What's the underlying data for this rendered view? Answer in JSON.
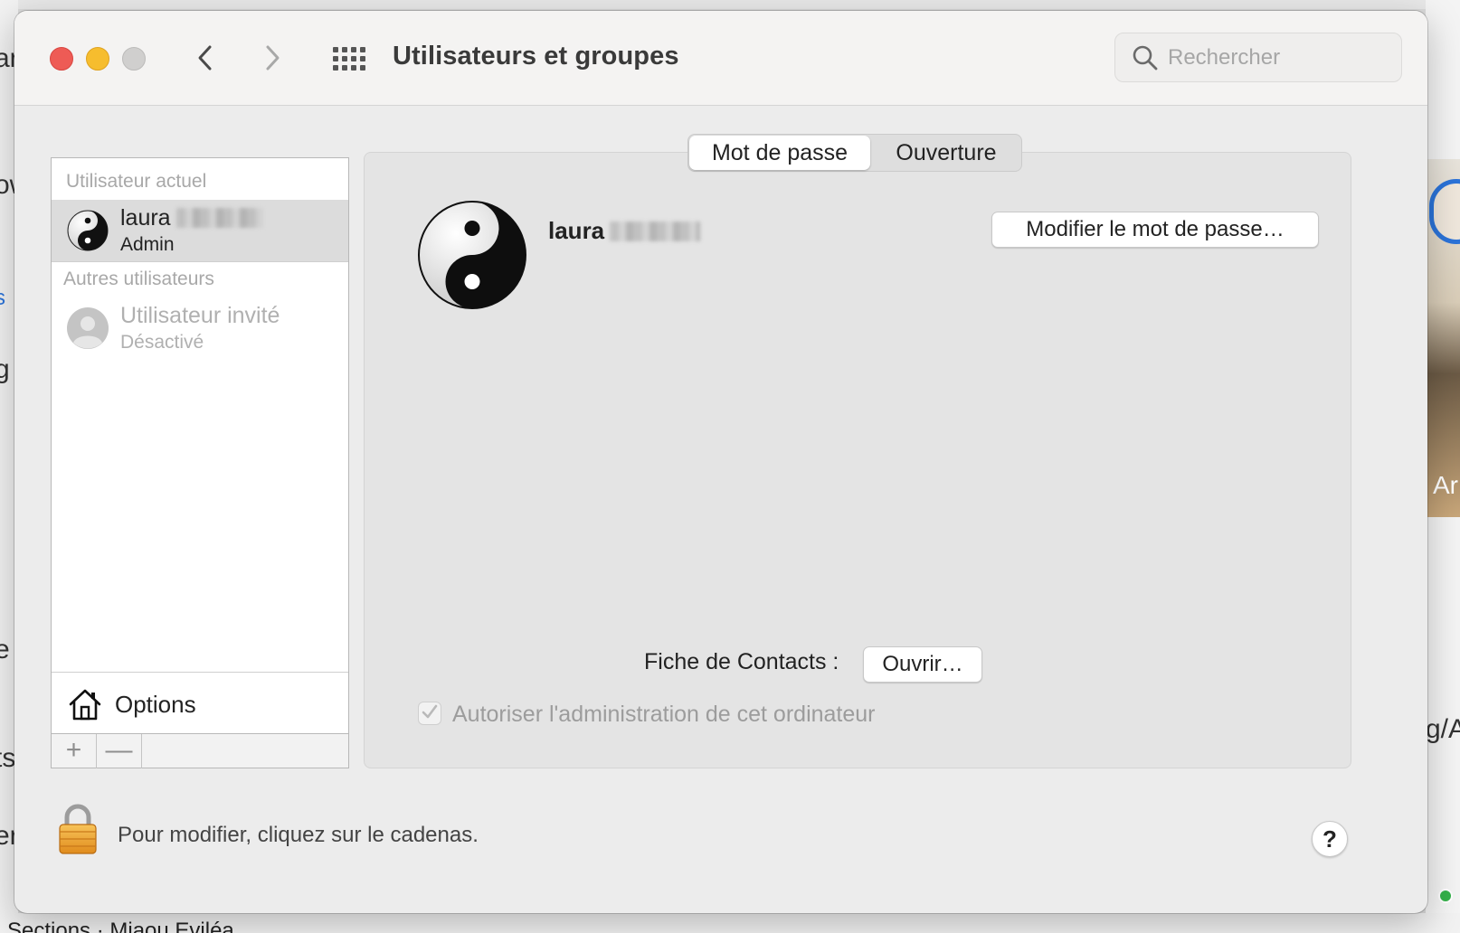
{
  "window": {
    "title": "Utilisateurs et groupes",
    "search_placeholder": "Rechercher"
  },
  "sidebar": {
    "current_label": "Utilisateur actuel",
    "current_user": {
      "name": "laura",
      "role": "Admin"
    },
    "others_label": "Autres utilisateurs",
    "guest_user": {
      "name": "Utilisateur invité",
      "status": "Désactivé"
    },
    "options_label": "Options",
    "add_symbol": "+",
    "remove_symbol": "—"
  },
  "tabs": [
    {
      "label": "Mot de passe",
      "selected": true
    },
    {
      "label": "Ouverture",
      "selected": false
    }
  ],
  "detail": {
    "user_name": "laura",
    "change_password_button": "Modifier le mot de passe…",
    "contacts_label": "Fiche de Contacts :",
    "open_button": "Ouvrir…",
    "admin_checkbox_label": "Autoriser l'administration de cet ordinateur",
    "admin_checked": true
  },
  "footer": {
    "lock_text": "Pour modifier, cliquez sur le cadenas.",
    "help_symbol": "?"
  },
  "background": {
    "left_fragments": [
      "ar",
      "ow",
      "s",
      "g",
      "e",
      "ts",
      "er"
    ],
    "right_fragments": [
      "Ar",
      "g/A"
    ],
    "bottom_fragment": "Sections · Miaou Eviléa"
  },
  "colors": {
    "close": "#ee5b55",
    "minimize": "#f6bd2e",
    "zoom_disabled": "#d0cfce",
    "selection": "#dcdcdc"
  }
}
